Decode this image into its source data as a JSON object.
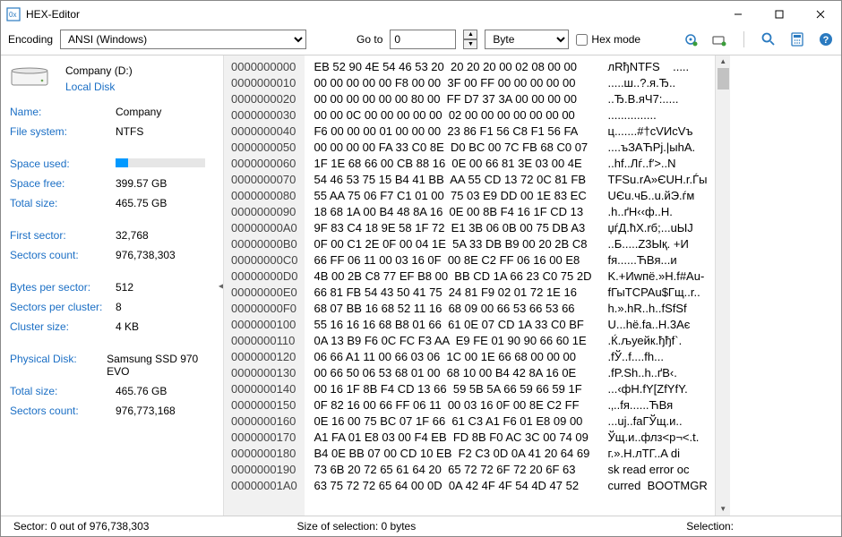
{
  "window": {
    "title": "HEX-Editor"
  },
  "toolbar": {
    "encoding_label": "Encoding",
    "encoding_value": "ANSI (Windows)",
    "goto_label": "Go to",
    "goto_value": "0",
    "unit_value": "Byte",
    "hexmode_label": "Hex mode"
  },
  "sidebar": {
    "disk_name": "Company (D:)",
    "disk_type": "Local Disk",
    "groups": [
      [
        {
          "k": "Name:",
          "v": "Company"
        },
        {
          "k": "File system:",
          "v": "NTFS"
        }
      ],
      [
        {
          "k": "Space used:",
          "v": "__BAR__"
        },
        {
          "k": "Space free:",
          "v": "399.57 GB"
        },
        {
          "k": "Total size:",
          "v": "465.75 GB"
        }
      ],
      [
        {
          "k": "First sector:",
          "v": "32,768"
        },
        {
          "k": "Sectors count:",
          "v": "976,738,303"
        }
      ],
      [
        {
          "k": "Bytes per sector:",
          "v": "512"
        },
        {
          "k": "Sectors per cluster:",
          "v": "8"
        },
        {
          "k": "Cluster size:",
          "v": "4 KB"
        }
      ],
      [
        {
          "k": "Physical Disk:",
          "v": "Samsung SSD 970 EVO"
        },
        {
          "k": "Total size:",
          "v": "465.76 GB"
        },
        {
          "k": "Sectors count:",
          "v": "976,773,168"
        }
      ]
    ],
    "usage_percent": 14
  },
  "hex": {
    "rows": [
      {
        "off": "0000000000",
        "b": "EB 52 90 4E 54 46 53 20  20 20 20 00 02 08 00 00",
        "a": "лRђNTFS    ....."
      },
      {
        "off": "0000000010",
        "b": "00 00 00 00 00 F8 00 00  3F 00 FF 00 00 00 00 00",
        "a": ".....ш..?.я.Ђ.."
      },
      {
        "off": "0000000020",
        "b": "00 00 00 00 00 00 80 00  FF D7 37 3A 00 00 00 00",
        "a": "..Ђ.В.яЧ7:....."
      },
      {
        "off": "0000000030",
        "b": "00 00 0C 00 00 00 00 00  02 00 00 00 00 00 00 00",
        "a": "..............."
      },
      {
        "off": "0000000040",
        "b": "F6 00 00 00 01 00 00 00  23 86 F1 56 C8 F1 56 FA",
        "a": "ц.......#†сVИсVъ"
      },
      {
        "off": "0000000050",
        "b": "00 00 00 00 FA 33 C0 8E  D0 BC 00 7C FB 68 C0 07",
        "a": "....ъЗАЋРј.|ыhА."
      },
      {
        "off": "0000000060",
        "b": "1F 1E 68 66 00 CB 88 16  0E 00 66 81 3E 03 00 4E",
        "a": "..hf..Лѓ..f′>..N"
      },
      {
        "off": "0000000070",
        "b": "54 46 53 75 15 B4 41 BB  AA 55 CD 13 72 0C 81 FB",
        "a": "TFSu.rА»ЄUН.r.Ѓы"
      },
      {
        "off": "0000000080",
        "b": "55 AA 75 06 F7 C1 01 00  75 03 E9 DD 00 1E 83 EC",
        "a": "UЄu.чБ..u.йЭ.ѓм"
      },
      {
        "off": "0000000090",
        "b": "18 68 1A 00 B4 48 8A 16  0E 00 8B F4 16 1F CD 13",
        "a": ".h..ґH‹‹ф..Н."
      },
      {
        "off": "00000000A0",
        "b": "9F 83 C4 18 9E 58 1F 72  E1 3B 06 0B 00 75 DB A3",
        "a": "џѓД.ћX.rб;...uЫЈ"
      },
      {
        "off": "00000000B0",
        "b": "0F 00 C1 2E 0F 00 04 1E  5A 33 DB B9 00 20 2B C8",
        "a": "..Б.....Z3Ық. +И"
      },
      {
        "off": "00000000C0",
        "b": "66 FF 06 11 00 03 16 0F  00 8E C2 FF 06 16 00 E8",
        "a": "fя......ЋВя...и"
      },
      {
        "off": "00000000D0",
        "b": "4B 00 2B C8 77 EF B8 00  BB CD 1A 66 23 C0 75 2D",
        "a": "K.+Иwпё.»Н.f#Аu-"
      },
      {
        "off": "00000000E0",
        "b": "66 81 FB 54 43 50 41 75  24 81 F9 02 01 72 1E 16",
        "a": "fГыTCPAu$Гщ..r.."
      },
      {
        "off": "00000000F0",
        "b": "68 07 BB 16 68 52 11 16  68 09 00 66 53 66 53 66",
        "a": "h.».hR..h..fSfSf"
      },
      {
        "off": "0000000100",
        "b": "55 16 16 16 68 B8 01 66  61 0E 07 CD 1A 33 C0 BF",
        "a": "U...hё.fa..Н.3Ає"
      },
      {
        "off": "0000000110",
        "b": "0A 13 B9 F6 0C FC F3 AA  E9 FE 01 90 90 66 60 1E",
        "a": ".Ќ.љуейк.ђђf`."
      },
      {
        "off": "0000000120",
        "b": "06 66 A1 11 00 66 03 06  1C 00 1E 66 68 00 00 00",
        "a": ".fЎ..f....fh..."
      },
      {
        "off": "0000000130",
        "b": "00 66 50 06 53 68 01 00  68 10 00 B4 42 8A 16 0E",
        "a": ".fP.Sh..h..ґB‹."
      },
      {
        "off": "0000000140",
        "b": "00 16 1F 8B F4 CD 13 66  59 5B 5A 66 59 66 59 1F",
        "a": "...‹фН.fY[ZfYfY."
      },
      {
        "off": "0000000150",
        "b": "0F 82 16 00 66 FF 06 11  00 03 16 0F 00 8E C2 FF",
        "a": ".‚..fя......ЋВя"
      },
      {
        "off": "0000000160",
        "b": "0E 16 00 75 BC 07 1F 66  61 C3 A1 F6 01 E8 09 00",
        "a": "...uј..faГЎщ.и.."
      },
      {
        "off": "0000000170",
        "b": "A1 FA 01 E8 03 00 F4 EB  FD 8B F0 AC 3C 00 74 09",
        "a": "Ўщ.и..флз<р¬<.t."
      },
      {
        "off": "0000000180",
        "b": "B4 0E BB 07 00 CD 10 EB  F2 C3 0D 0A 41 20 64 69",
        "a": "г.».Н.лТГ..A di"
      },
      {
        "off": "0000000190",
        "b": "73 6B 20 72 65 61 64 20  65 72 72 6F 72 20 6F 63",
        "a": "sk read error oc"
      },
      {
        "off": "00000001A0",
        "b": "63 75 72 72 65 64 00 0D  0A 42 4F 4F 54 4D 47 52",
        "a": "curred  BOOTMGR"
      }
    ]
  },
  "status": {
    "sector": "Sector: 0 out of 976,738,303",
    "selection_size": "Size of selection: 0 bytes",
    "selection": "Selection:"
  }
}
